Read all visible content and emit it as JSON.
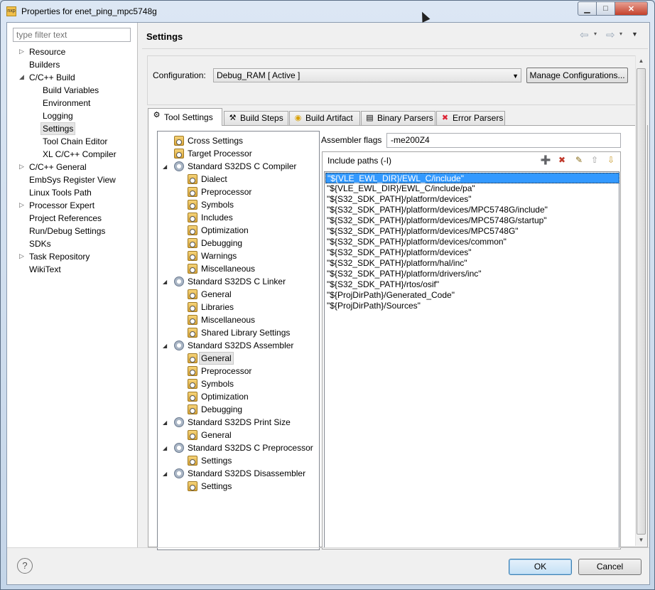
{
  "window": {
    "title": "Properties for enet_ping_mpc5748g",
    "app_icon": "nxp-icon",
    "controls": {
      "minimize": "▁",
      "maximize": "□",
      "close": "✕"
    }
  },
  "left_pane": {
    "filter_placeholder": "type filter text",
    "items": [
      {
        "label": "Resource",
        "expand": "▷"
      },
      {
        "label": "Builders"
      },
      {
        "label": "C/C++ Build",
        "expand": "◢"
      },
      {
        "label": "Build Variables"
      },
      {
        "label": "Environment"
      },
      {
        "label": "Logging"
      },
      {
        "label": "Settings",
        "selected": true
      },
      {
        "label": "Tool Chain Editor"
      },
      {
        "label": "XL C/C++ Compiler"
      },
      {
        "label": "C/C++ General",
        "expand": "▷"
      },
      {
        "label": "EmbSys Register View"
      },
      {
        "label": "Linux Tools Path"
      },
      {
        "label": "Processor Expert",
        "expand": "▷"
      },
      {
        "label": "Project References"
      },
      {
        "label": "Run/Debug Settings"
      },
      {
        "label": "SDKs"
      },
      {
        "label": "Task Repository",
        "expand": "▷"
      },
      {
        "label": "WikiText"
      }
    ]
  },
  "header": {
    "title": "Settings",
    "back_icon": "⇦",
    "forward_icon": "⇨",
    "dropdown_icon": "▾",
    "view_menu_icon": "▼"
  },
  "configuration": {
    "label": "Configuration:",
    "value": "Debug_RAM  [ Active ]",
    "dropdown": "▼",
    "manage_label": "Manage Configurations..."
  },
  "tabs": [
    {
      "label": "Tool Settings",
      "icon": "⚙",
      "active": true
    },
    {
      "label": "Build Steps",
      "icon": "⚒"
    },
    {
      "label": "Build Artifact",
      "icon": "◉"
    },
    {
      "label": "Binary Parsers",
      "icon": "▤"
    },
    {
      "label": "Error Parsers",
      "icon": "✖"
    }
  ],
  "tool_tree": [
    {
      "label": "Cross Settings"
    },
    {
      "label": "Target Processor"
    },
    {
      "label": "Standard S32DS C Compiler"
    },
    {
      "label": "Dialect"
    },
    {
      "label": "Preprocessor"
    },
    {
      "label": "Symbols"
    },
    {
      "label": "Includes"
    },
    {
      "label": "Optimization"
    },
    {
      "label": "Debugging"
    },
    {
      "label": "Warnings"
    },
    {
      "label": "Miscellaneous"
    },
    {
      "label": "Standard S32DS C Linker"
    },
    {
      "label": "General"
    },
    {
      "label": "Libraries"
    },
    {
      "label": "Miscellaneous"
    },
    {
      "label": "Shared Library Settings"
    },
    {
      "label": "Standard S32DS Assembler"
    },
    {
      "label": "General",
      "selected": true
    },
    {
      "label": "Preprocessor"
    },
    {
      "label": "Symbols"
    },
    {
      "label": "Optimization"
    },
    {
      "label": "Debugging"
    },
    {
      "label": "Standard S32DS Print Size"
    },
    {
      "label": "General"
    },
    {
      "label": "Standard S32DS C Preprocessor"
    },
    {
      "label": "Settings"
    },
    {
      "label": "Standard S32DS Disassembler"
    },
    {
      "label": "Settings"
    }
  ],
  "tree_arrow": "◢",
  "assembler": {
    "flags_label": "Assembler flags",
    "flags_value": "-me200Z4"
  },
  "include_paths": {
    "label": "Include paths (-I)",
    "toolbar": [
      {
        "name": "add-icon",
        "glyph": "➕",
        "color": "#2a8a2a"
      },
      {
        "name": "delete-icon",
        "glyph": "✖",
        "color": "#c0392b"
      },
      {
        "name": "edit-icon",
        "glyph": "✎",
        "color": "#8a6d1a"
      },
      {
        "name": "move-up-icon",
        "glyph": "⇧",
        "color": "#999999"
      },
      {
        "name": "move-down-icon",
        "glyph": "⇩",
        "color": "#c89a2a"
      }
    ],
    "paths": [
      "\"${VLE_EWL_DIR}/EWL_C/include\"",
      "\"${VLE_EWL_DIR}/EWL_C/include/pa\"",
      "\"${S32_SDK_PATH}/platform/devices\"",
      "\"${S32_SDK_PATH}/platform/devices/MPC5748G/include\"",
      "\"${S32_SDK_PATH}/platform/devices/MPC5748G/startup\"",
      "\"${S32_SDK_PATH}/platform/devices/MPC5748G\"",
      "\"${S32_SDK_PATH}/platform/devices/common\"",
      "\"${S32_SDK_PATH}/platform/devices\"",
      "\"${S32_SDK_PATH}/platform/hal/inc\"",
      "\"${S32_SDK_PATH}/platform/drivers/inc\"",
      "\"${S32_SDK_PATH}/rtos/osif\"",
      "\"${ProjDirPath}/Generated_Code\"",
      "\"${ProjDirPath}/Sources\""
    ],
    "selected_index": 0
  },
  "scrollbar": {
    "up": "▲",
    "down": "▼"
  },
  "footer": {
    "help": "?",
    "ok_label": "OK",
    "cancel_label": "Cancel"
  }
}
